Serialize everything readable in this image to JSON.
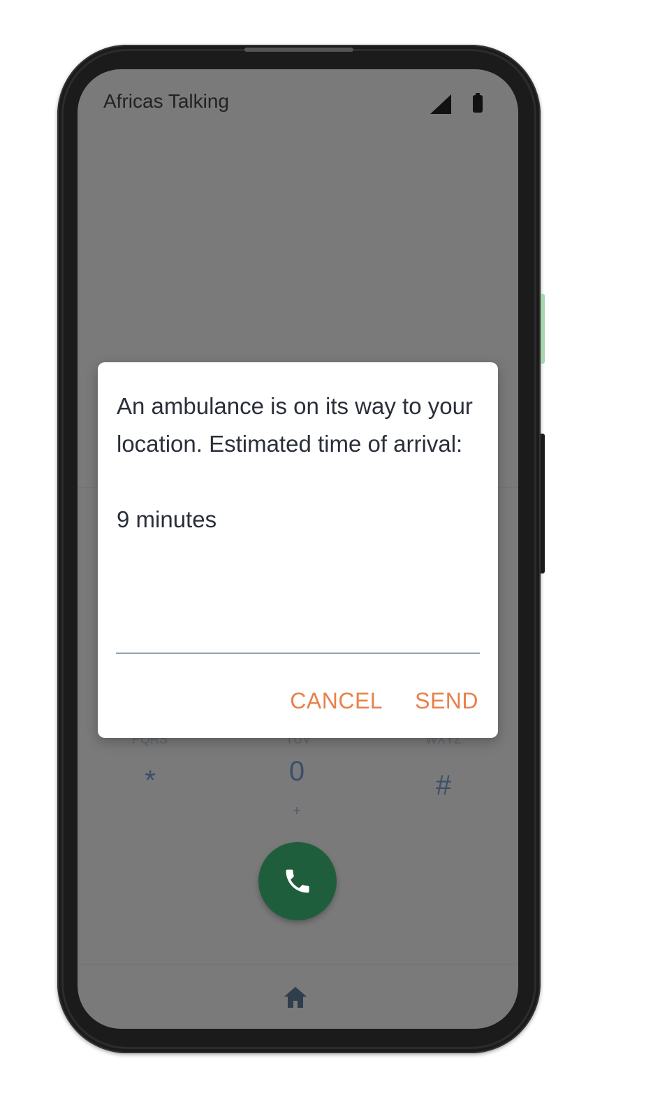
{
  "app": {
    "title": "Africas Talking"
  },
  "status_bar": {
    "icons": [
      "signal-icon",
      "battery-icon"
    ]
  },
  "dialpad": {
    "keys": [
      {
        "label": "*",
        "sub": ""
      },
      {
        "label": "0",
        "sub": "+"
      },
      {
        "label": "#",
        "sub": ""
      }
    ]
  },
  "call_button": {
    "icon": "phone-icon",
    "color": "#1f5e3c"
  },
  "nav": {
    "icon": "home-icon"
  },
  "dialog": {
    "message": "An ambulance is on its way to your location. Estimated time of arrival:\n\n9 minutes",
    "input_value": "",
    "cancel_label": "CANCEL",
    "send_label": "SEND",
    "accent_color": "#e8814a"
  }
}
